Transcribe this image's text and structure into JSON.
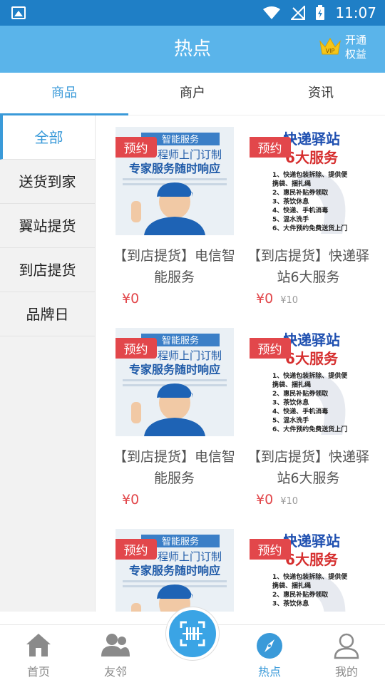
{
  "statusbar": {
    "time": "11:07"
  },
  "header": {
    "title": "热点",
    "vip_line1": "开通",
    "vip_line2": "权益",
    "vip_badge": "VIP"
  },
  "tabs": [
    {
      "label": "商品",
      "active": true
    },
    {
      "label": "商户",
      "active": false
    },
    {
      "label": "资讯",
      "active": false
    }
  ],
  "sidebar": {
    "items": [
      {
        "label": "全部",
        "active": true
      },
      {
        "label": "送货到家"
      },
      {
        "label": "翼站提货"
      },
      {
        "label": "到店提货"
      },
      {
        "label": "品牌日"
      }
    ]
  },
  "products": [
    {
      "tag": "预约",
      "name": "【到店提货】电信智能服务",
      "price": "¥0",
      "old_price": "",
      "image": "service",
      "img_text": {
        "head": "智能服务",
        "line1": "程师上门订制",
        "line2": "专家服务随时响应"
      }
    },
    {
      "tag": "预约",
      "name": "【到店提货】快递驿站6大服务",
      "price": "¥0",
      "old_price": "¥10",
      "image": "express",
      "img_text": {
        "head": "快递驿站",
        "line1": "6大服务",
        "list": [
          "1、快递包装拆除、提供便",
          "携袋、捆扎绳",
          "2、惠民补贴券领取",
          "3、茶饮休息",
          "4、快递、手机消毒",
          "5、温水洗手",
          "6、大件预约免费送货上门"
        ]
      }
    },
    {
      "tag": "预约",
      "name": "【到店提货】电信智能服务",
      "price": "¥0",
      "old_price": "",
      "image": "service",
      "img_text": {
        "head": "智能服务",
        "line1": "程师上门订制",
        "line2": "专家服务随时响应"
      }
    },
    {
      "tag": "预约",
      "name": "【到店提货】快递驿站6大服务",
      "price": "¥0",
      "old_price": "¥10",
      "image": "express",
      "img_text": {
        "head": "快递驿站",
        "line1": "6大服务",
        "list": [
          "1、快递包装拆除、提供便",
          "携袋、捆扎绳",
          "2、惠民补贴券领取",
          "3、茶饮休息",
          "4、快递、手机消毒",
          "5、温水洗手",
          "6、大件预约免费送货上门"
        ]
      }
    },
    {
      "tag": "预约",
      "name": "",
      "price": "",
      "old_price": "",
      "image": "service",
      "img_text": {
        "head": "智能服务",
        "line1": "程师上门订制",
        "line2": "专家服务随时响应"
      }
    },
    {
      "tag": "预约",
      "name": "",
      "price": "",
      "old_price": "",
      "image": "express",
      "img_text": {
        "head": "快递驿站",
        "line1": "6大服务",
        "list": [
          "1、快递包装拆除、提供便",
          "携袋、捆扎绳",
          "2、惠民补贴券领取",
          "3、茶饮休息"
        ]
      }
    }
  ],
  "bottomnav": [
    {
      "label": "首页",
      "icon": "home-icon"
    },
    {
      "label": "友邻",
      "icon": "friends-icon"
    },
    {
      "label": "热点",
      "icon": "compass-icon",
      "active": true
    },
    {
      "label": "我的",
      "icon": "user-icon"
    }
  ],
  "colors": {
    "accent": "#3a9ad9",
    "header_bg": "#5ab4ea",
    "statusbar_bg": "#1f7fc6",
    "price": "#e2474b"
  }
}
